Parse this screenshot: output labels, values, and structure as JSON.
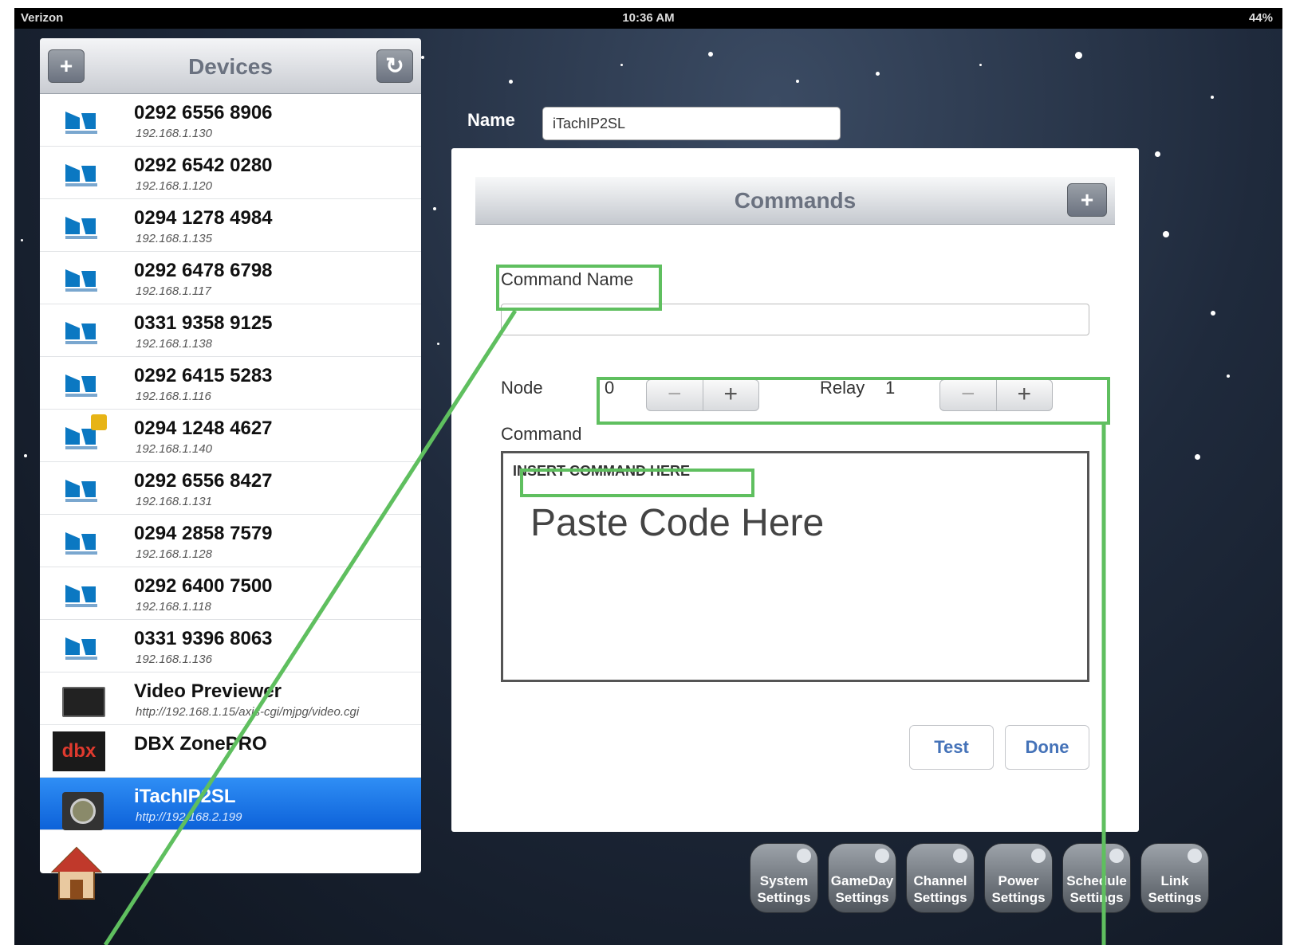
{
  "status_bar": {
    "carrier": "Verizon",
    "time": "10:36 AM",
    "battery": "44%"
  },
  "devices_panel": {
    "title": "Devices",
    "add_label": "+",
    "refresh_label": "↻",
    "items": [
      {
        "name": "0292 6556 8906",
        "address": "192.168.1.130",
        "icon": "directv-icon"
      },
      {
        "name": "0292 6542 0280",
        "address": "192.168.1.120",
        "icon": "directv-icon"
      },
      {
        "name": "0294 1278 4984",
        "address": "192.168.1.135",
        "icon": "directv-icon"
      },
      {
        "name": "0292 6478 6798",
        "address": "192.168.1.117",
        "icon": "directv-icon"
      },
      {
        "name": "0331 9358 9125",
        "address": "192.168.1.138",
        "icon": "directv-icon"
      },
      {
        "name": "0292 6415 5283",
        "address": "192.168.1.116",
        "icon": "directv-icon"
      },
      {
        "name": "0294 1248 4627",
        "address": "192.168.1.140",
        "icon": "directv-locked-icon"
      },
      {
        "name": "0292 6556 8427",
        "address": "192.168.1.131",
        "icon": "directv-icon"
      },
      {
        "name": "0294 2858 7579",
        "address": "192.168.1.128",
        "icon": "directv-icon"
      },
      {
        "name": "0292 6400 7500",
        "address": "192.168.1.118",
        "icon": "directv-icon"
      },
      {
        "name": "0331 9396 8063",
        "address": "192.168.1.136",
        "icon": "directv-icon"
      },
      {
        "name": "Video Previewer",
        "address": "http://192.168.1.15/axis-cgi/mjpg/video.cgi",
        "icon": "video-monitor-icon"
      },
      {
        "name": "DBX ZonePRO",
        "address": "",
        "icon": "dbx-logo-icon"
      },
      {
        "name": "iTachIP2SL",
        "address": "http://192.168.2.199",
        "icon": "itach-device-icon",
        "selected": true
      }
    ]
  },
  "device_name": {
    "label": "Name",
    "value": "iTachIP2SL"
  },
  "commands_panel": {
    "title": "Commands",
    "add_label": "+",
    "command_name_label": "Command Name",
    "command_name_value": "",
    "node_label": "Node",
    "node_value": "0",
    "relay_label": "Relay",
    "relay_value": "1",
    "minus_label": "−",
    "plus_label": "+",
    "command_label": "Command",
    "command_placeholder": "INSERT COMMAND HERE",
    "paste_hint": "Paste Code Here",
    "test_label": "Test",
    "done_label": "Done"
  },
  "dock": [
    {
      "line1": "System",
      "line2": "Settings",
      "icon": "tools-icon"
    },
    {
      "line1": "GameDay",
      "line2": "Settings",
      "icon": "tv-icon"
    },
    {
      "line1": "Channel",
      "line2": "Settings",
      "icon": "channel-icon"
    },
    {
      "line1": "Power",
      "line2": "Settings",
      "icon": "power-icon"
    },
    {
      "line1": "Schedule",
      "line2": "Settings",
      "icon": "clock-icon"
    },
    {
      "line1": "Link",
      "line2": "Settings",
      "icon": "link-icon"
    }
  ],
  "colors": {
    "highlight": "#5fbf5f",
    "selected_row": "#1874e6",
    "button_text": "#4472b8"
  }
}
